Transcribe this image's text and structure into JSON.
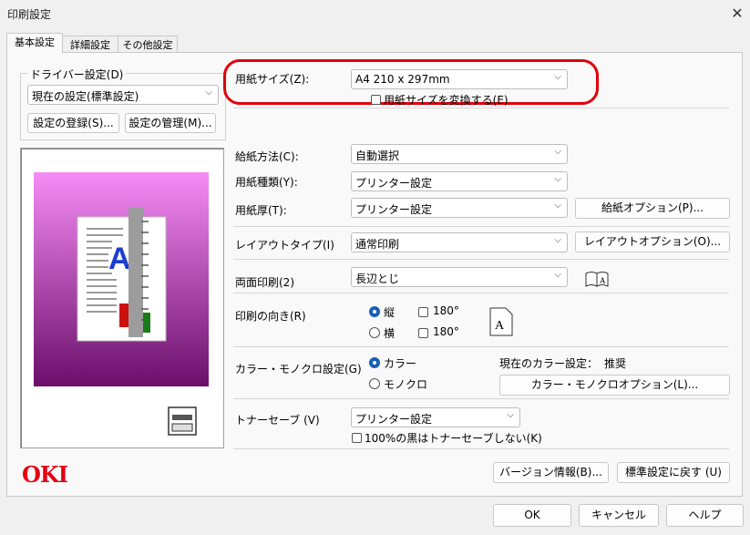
{
  "window": {
    "title": "印刷設定",
    "close_symbol": "✕"
  },
  "tabs": [
    {
      "label": "基本設定"
    },
    {
      "label": "詳細設定"
    },
    {
      "label": "その他設定"
    }
  ],
  "driver_group": {
    "title": "ドライバー設定(D)",
    "selected": "現在の設定(標準設定)",
    "register_button": "設定の登録(S)...",
    "manage_button": "設定の管理(M)..."
  },
  "paper_size": {
    "label": "用紙サイズ(Z):",
    "value": "A4 210 x 297mm",
    "convert_label": "用紙サイズを変換する(E)"
  },
  "paper_source": {
    "label": "給紙方法(C):",
    "value": "自動選択"
  },
  "paper_type": {
    "label": "用紙種類(Y):",
    "value": "プリンター設定"
  },
  "paper_weight": {
    "label": "用紙厚(T):",
    "value": "プリンター設定",
    "options_button": "給紙オプション(P)..."
  },
  "layout": {
    "label": "レイアウトタイプ(I)",
    "value": "通常印刷",
    "options_button": "レイアウトオプション(O)..."
  },
  "duplex": {
    "label": "両面印刷(2)",
    "value": "長辺とじ"
  },
  "orientation": {
    "label": "印刷の向き(R)",
    "portrait": "縦",
    "landscape": "横",
    "rotate_180": "180°"
  },
  "color": {
    "label": "カラー・モノクロ設定(G)",
    "color_option": "カラー",
    "mono_option": "モノクロ",
    "current_label": "現在のカラー設定：",
    "current_value": "推奨",
    "options_button": "カラー・モノクロオプション(L)..."
  },
  "toner": {
    "label": "トナーセーブ (V)",
    "value": "プリンター設定",
    "no_save_black_label": "100%の黒はトナーセーブしない(K)"
  },
  "brand": {
    "logo": "OKI",
    "logo_color": "#e60012"
  },
  "footer_panel": {
    "version_button": "バージョン情報(B)...",
    "restore_button": "標準設定に戻す (U)"
  },
  "dialog_buttons": {
    "ok": "OK",
    "cancel": "キャンセル",
    "help": "ヘルプ"
  },
  "colors": {
    "accent": "#1a5fb4",
    "highlight": "#e0000a"
  }
}
